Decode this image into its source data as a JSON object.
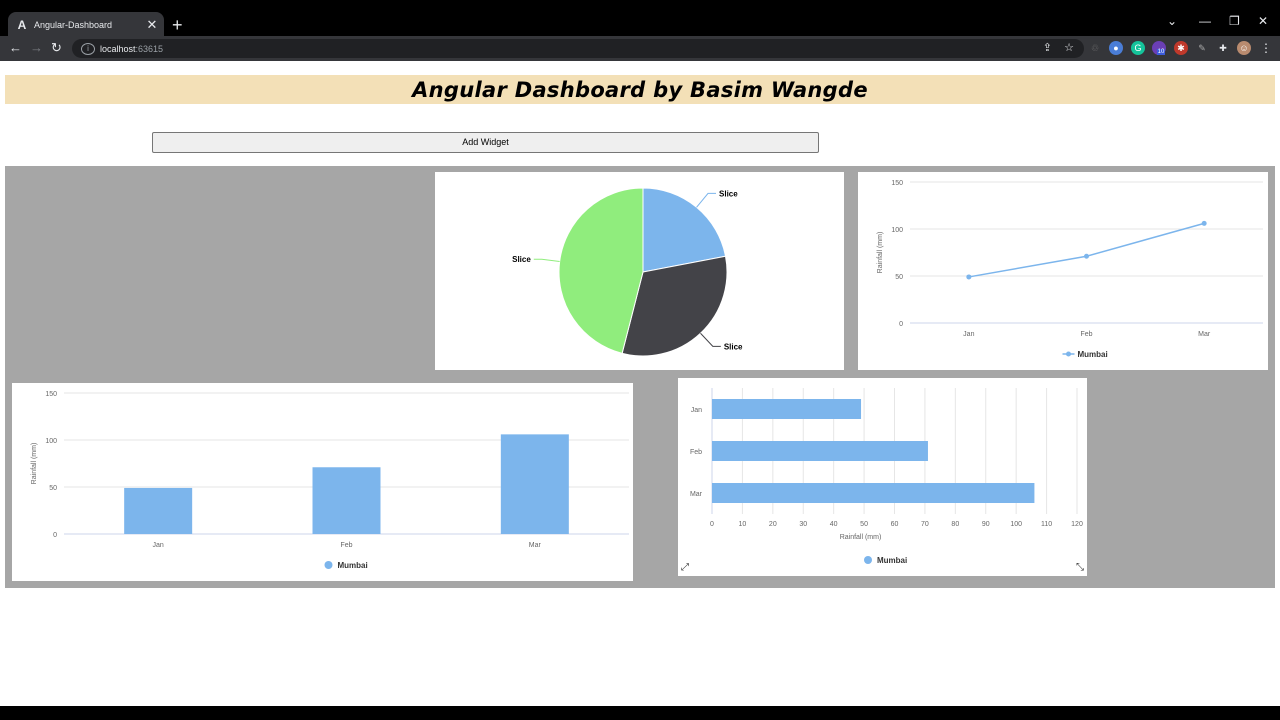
{
  "browser": {
    "tab_title": "Angular-Dashboard",
    "url_host": "localhost",
    "url_port": ":63615",
    "ext_badge": "10"
  },
  "page": {
    "title": "Angular Dashboard by Basim Wangde",
    "add_widget_label": "Add Widget"
  },
  "colors": {
    "blue": "#7cb5ec",
    "dark": "#434348",
    "green": "#90ed7d",
    "header_bg": "#f3e0b7",
    "grid_bg": "#a6a6a6"
  },
  "chart_data": [
    {
      "type": "pie",
      "slices": [
        {
          "label": "Slice",
          "value": 22,
          "color": "#7cb5ec"
        },
        {
          "label": "Slice",
          "value": 32,
          "color": "#434348"
        },
        {
          "label": "Slice",
          "value": 46,
          "color": "#90ed7d"
        }
      ]
    },
    {
      "type": "line",
      "categories": [
        "Jan",
        "Feb",
        "Mar"
      ],
      "series": [
        {
          "name": "Mumbai",
          "values": [
            49,
            71,
            106
          ],
          "color": "#7cb5ec"
        }
      ],
      "ylabel": "Rainfall (mm)",
      "ylim": [
        0,
        150
      ],
      "yticks": [
        0,
        50,
        100,
        150
      ],
      "legend": "bottom"
    },
    {
      "type": "bar",
      "categories": [
        "Jan",
        "Feb",
        "Mar"
      ],
      "series": [
        {
          "name": "Mumbai",
          "values": [
            49,
            71,
            106
          ],
          "color": "#7cb5ec"
        }
      ],
      "ylabel": "Rainfall (mm)",
      "ylim": [
        0,
        150
      ],
      "yticks": [
        0,
        50,
        100,
        150
      ],
      "legend": "bottom"
    },
    {
      "type": "bar",
      "orientation": "horizontal",
      "categories": [
        "Jan",
        "Feb",
        "Mar"
      ],
      "series": [
        {
          "name": "Mumbai",
          "values": [
            49,
            71,
            106
          ],
          "color": "#7cb5ec"
        }
      ],
      "xlabel": "Rainfall (mm)",
      "xlim": [
        0,
        120
      ],
      "xticks": [
        0,
        10,
        20,
        30,
        40,
        50,
        60,
        70,
        80,
        90,
        100,
        110,
        120
      ],
      "legend": "bottom"
    }
  ]
}
